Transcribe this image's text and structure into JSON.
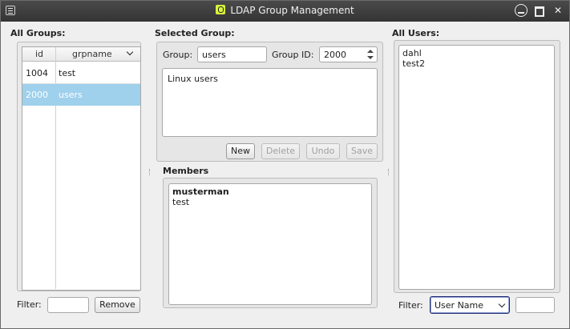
{
  "window": {
    "title": "LDAP Group Management"
  },
  "groups": {
    "label": "All Groups:",
    "columns": {
      "id": "id",
      "name": "grpname"
    },
    "rows": [
      {
        "id": "1004",
        "name": "test"
      },
      {
        "id": "2000",
        "name": "users"
      }
    ],
    "filter_label": "Filter:",
    "filter_value": "",
    "remove_label": "Remove"
  },
  "selected": {
    "label": "Selected Group:",
    "group_label": "Group:",
    "group_value": "users",
    "gid_label": "Group ID:",
    "gid_value": "2000",
    "description": "Linux users",
    "buttons": {
      "new": "New",
      "delete": "Delete",
      "undo": "Undo",
      "save": "Save"
    },
    "members_label": "Members",
    "members": [
      "musterman",
      "test"
    ]
  },
  "users": {
    "label": "All Users:",
    "items": [
      "dahl",
      "test2"
    ],
    "filter_label": "Filter:",
    "filter_field": "User Name",
    "filter_value": ""
  }
}
